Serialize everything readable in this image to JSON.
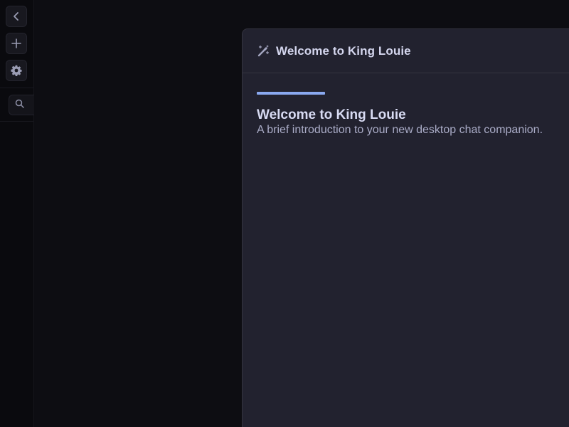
{
  "sidebar": {
    "buttons": [
      {
        "icon": "chevron-left-icon"
      },
      {
        "icon": "plus-icon"
      },
      {
        "icon": "gear-icon"
      }
    ],
    "search": {
      "icon": "search-icon"
    }
  },
  "modal": {
    "header_icon": "magic-wand-icon",
    "title": "Welcome to King Louie",
    "step": {
      "title": "Welcome to King Louie",
      "subtitle": "A brief introduction to your new desktop chat companion."
    },
    "progress_fraction": 0.2
  },
  "colors": {
    "accent": "#8aa9f0",
    "modal_bg": "#22222f",
    "app_bg": "#0c0c12"
  }
}
